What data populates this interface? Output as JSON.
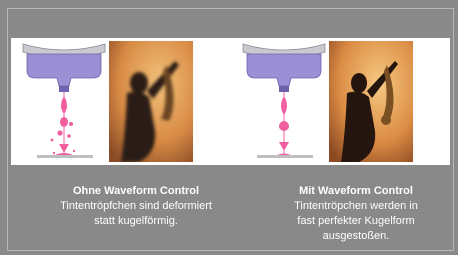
{
  "left": {
    "title": "Ohne Waveform Control",
    "line1": "Tintentröpfchen sind deformiert",
    "line2": "statt kugelförmig."
  },
  "right": {
    "title": "Mit Waveform Control",
    "line1": "Tintentröpchen werden in",
    "line2": "fast perfekter Kugelform",
    "line3": "ausgestoßen."
  },
  "colors": {
    "nozzle_purple": "#9b8fd6",
    "droplet_pink": "#f05fa0",
    "background": "#898989"
  }
}
